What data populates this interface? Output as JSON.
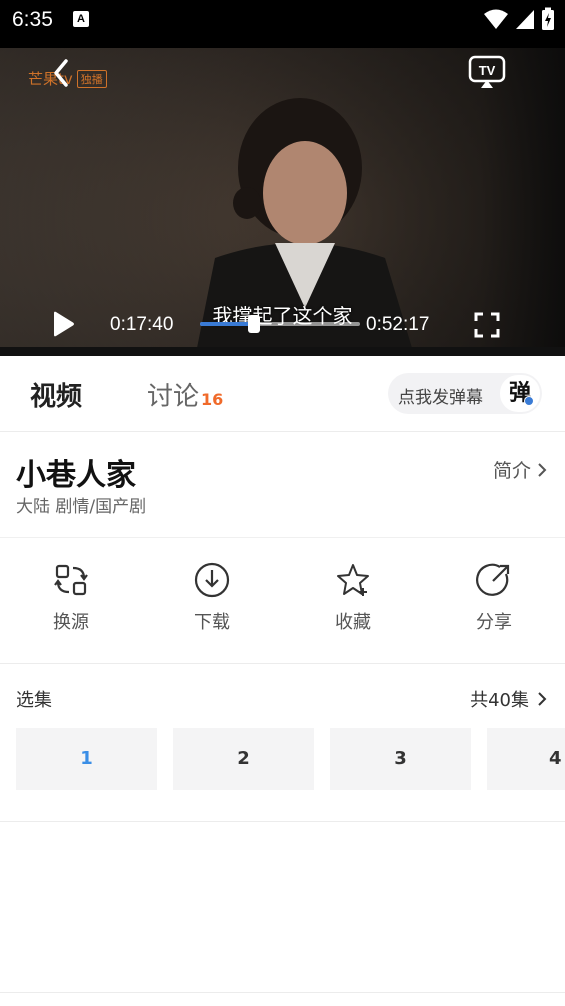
{
  "status_bar": {
    "time": "6:35",
    "notif_letter": "A"
  },
  "player": {
    "brand": "芒果tv",
    "brand_badge": "独播",
    "subtitle": "我撑起了这个家",
    "current_time": "0:17:40",
    "total_time": "0:52:17",
    "progress_fraction": 0.338,
    "tv_label": "TV"
  },
  "tabs": [
    {
      "label": "视频",
      "count": ""
    },
    {
      "label": "讨论",
      "count": "16"
    }
  ],
  "danmu": {
    "label": "点我发弹幕",
    "icon_char": "弹"
  },
  "show": {
    "title": "小巷人家",
    "meta": "大陆 剧情/国产剧",
    "intro_label": "简介"
  },
  "actions": [
    {
      "label": "换源",
      "icon": "switch-source-icon"
    },
    {
      "label": "下载",
      "icon": "download-icon"
    },
    {
      "label": "收藏",
      "icon": "star-icon"
    },
    {
      "label": "分享",
      "icon": "share-icon"
    }
  ],
  "episodes": {
    "header": "选集",
    "total_label": "共40集",
    "items": [
      "1",
      "2",
      "3",
      "4"
    ],
    "active_index": 0
  },
  "colors": {
    "accent": "#3a8ee6",
    "count_orange": "#f06a2a",
    "brand_orange": "#e07a2a"
  }
}
